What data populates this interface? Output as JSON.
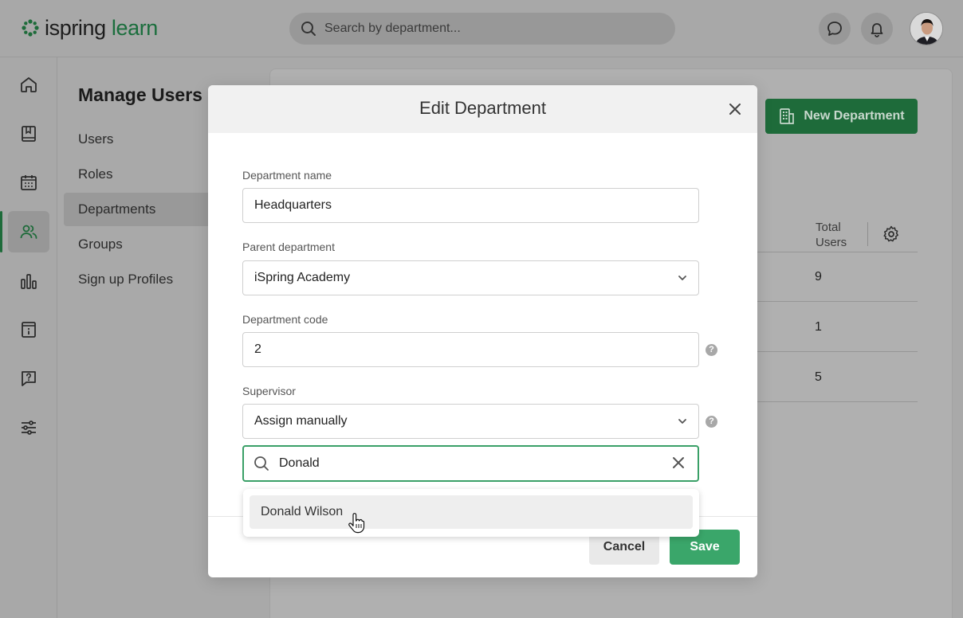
{
  "app": {
    "logo_word_1": "ispring",
    "logo_word_2": "learn",
    "search_placeholder": "Search by department..."
  },
  "subnav": {
    "title": "Manage Users",
    "items": [
      {
        "label": "Users"
      },
      {
        "label": "Roles"
      },
      {
        "label": "Departments"
      },
      {
        "label": "Groups"
      },
      {
        "label": "Sign up Profiles"
      }
    ]
  },
  "main": {
    "new_department_label": "New Department",
    "total_users_header": "Total Users",
    "total_users_values": [
      "9",
      "1",
      "5"
    ]
  },
  "modal": {
    "title": "Edit Department",
    "department_name_label": "Department name",
    "department_name_value": "Headquarters",
    "parent_department_label": "Parent department",
    "parent_department_value": "iSpring Academy",
    "department_code_label": "Department code",
    "department_code_value": "2",
    "supervisor_label": "Supervisor",
    "supervisor_value": "Assign manually",
    "supervisor_search_value": "Donald",
    "supervisor_suggestions": [
      "Donald Wilson"
    ],
    "cancel_label": "Cancel",
    "save_label": "Save"
  },
  "colors": {
    "brand_green": "#1e6b3a",
    "accent_green": "#3aa66a",
    "focus_border": "#3aa067"
  }
}
